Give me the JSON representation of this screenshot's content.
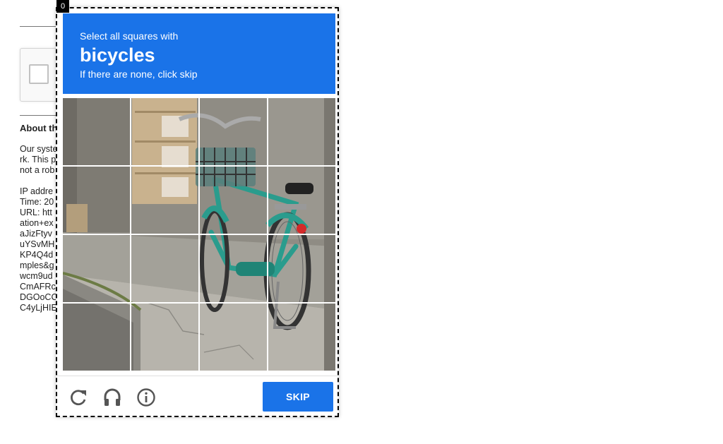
{
  "background_page": {
    "about_heading": "About th",
    "text_lines": [
      "Our syste",
      "rk. This p",
      "not a rob",
      "",
      "IP addre",
      "Time: 20",
      "URL: htt",
      "ation+ex",
      "aJizFtyv",
      "uYSvMH",
      "KP4Q4d",
      "mples&g",
      "wcm9ud",
      "CmAFRc",
      "DGOoCC",
      "C4yLjHIE"
    ]
  },
  "focus_badge": "0",
  "challenge": {
    "instruction_prefix": "Select all squares with",
    "keyword": "bicycles",
    "instruction_suffix": "If there are none, click skip",
    "grid": {
      "rows": 4,
      "cols": 4
    },
    "skip_label": "SKIP",
    "icons": [
      "reload-icon",
      "audio-icon",
      "info-icon"
    ],
    "accent_color": "#1a73e8"
  }
}
